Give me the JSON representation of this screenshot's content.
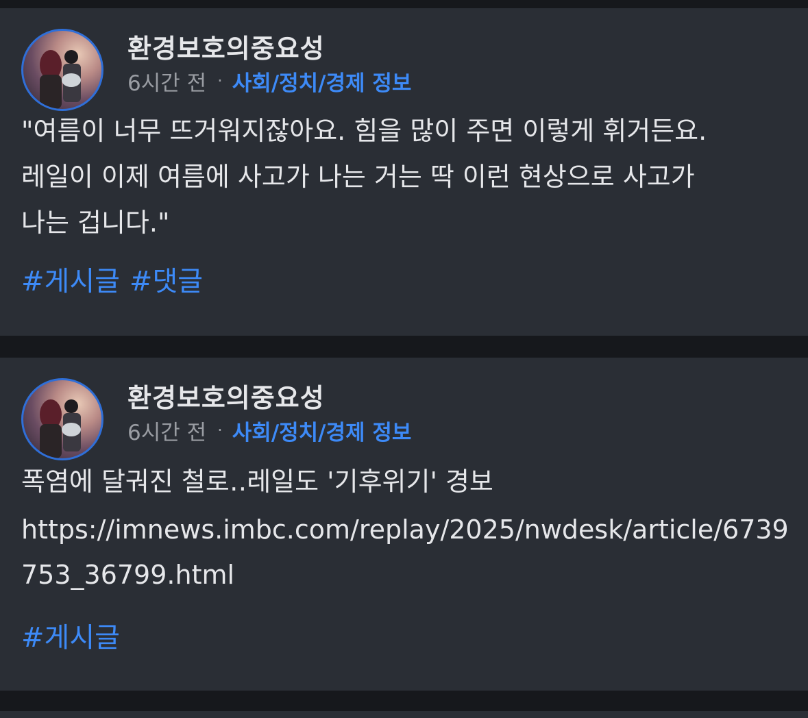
{
  "posts": [
    {
      "username": "환경보호의중요성",
      "time": "6시간 전",
      "separator": "·",
      "category": "사회/정치/경제 정보",
      "body": "\"여름이 너무 뜨거워지잖아요. 힘을 많이 주면 이렇게 휘거든요.\n레일이 이제 여름에 사고가 나는 거는 딱 이런 현상으로 사고가\n나는 겁니다.\"",
      "tags": [
        "#게시글",
        "#댓글"
      ]
    },
    {
      "username": "환경보호의중요성",
      "time": "6시간 전",
      "separator": "·",
      "category": "사회/정치/경제 정보",
      "title": "폭염에 달궈진 철로‥레일도 '기후위기' 경보",
      "link": "https://imnews.imbc.com/replay/2025/nwdesk/article/6739753_36799.html",
      "tags": [
        "#게시글"
      ]
    }
  ],
  "colors": {
    "background": "#16181c",
    "card": "#2a2e35",
    "text": "#e6e7ea",
    "muted": "#9a9da3",
    "accent": "#3d8af7",
    "avatar_ring": "#2f6fd8"
  }
}
